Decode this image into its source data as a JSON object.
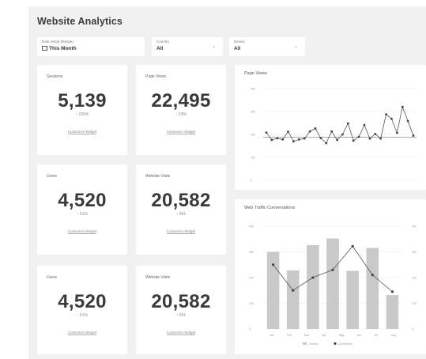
{
  "page": {
    "title": "Website Analytics"
  },
  "filters": [
    {
      "label": "Date range (Range)",
      "value": "This Month",
      "icon": "calendar-icon"
    },
    {
      "label": "Country",
      "value": "All",
      "icon": "chevron-down-icon"
    },
    {
      "label": "Device",
      "value": "All",
      "icon": "chevron-down-icon"
    }
  ],
  "cards": [
    {
      "label": "Sessions",
      "value": "5,139",
      "delta": "↑ 100%",
      "link": "Customize Widget"
    },
    {
      "label": "Page Views",
      "value": "22,495",
      "delta": "↑ 23%",
      "link": "Customize Widget"
    },
    {
      "label": "Users",
      "value": "4,520",
      "delta": "↑ 91%",
      "link": "Customize Widget"
    },
    {
      "label": "Website Visits",
      "value": "20,582",
      "delta": "↑ 591",
      "link": "Customize Widget"
    },
    {
      "label": "Users",
      "value": "4,520",
      "delta": "↑ 91%",
      "link": "Customize Widget"
    },
    {
      "label": "Website Visits",
      "value": "20,582",
      "delta": "↑ 591",
      "link": "Customize Widget"
    }
  ],
  "colors": {
    "background": "#f1f1f1",
    "card": "#ffffff",
    "bar": "#c9c9c9",
    "line": "#555555"
  },
  "chart_data": [
    {
      "type": "line",
      "title": "Page Views",
      "ylim": [
        0,
        400
      ],
      "yticks": [
        "400",
        "300",
        "200",
        "100",
        "0"
      ],
      "values": [
        208,
        176,
        183,
        178,
        212,
        170,
        178,
        182,
        213,
        226,
        184,
        162,
        213,
        176,
        200,
        248,
        173,
        190,
        241,
        182,
        202,
        182,
        288,
        268,
        207,
        320,
        258,
        195
      ],
      "reference_value": 188,
      "grid": true
    },
    {
      "type": "bar",
      "title": "Web Traffic Conversations",
      "categories": [
        "Jan",
        "Feb",
        "Mar",
        "Apr",
        "May",
        "Jun",
        "Jul",
        "Aug"
      ],
      "series": [
        {
          "type": "bar",
          "values": [
            300,
            228,
            326,
            352,
            226,
            315,
            132
          ]
        },
        {
          "type": "line",
          "values": [
            250,
            150,
            200,
            230,
            322,
            210,
            145
          ]
        }
      ],
      "ylim": [
        0,
        400
      ],
      "yticks_left": [
        "400",
        "300",
        "200",
        "100",
        "0"
      ],
      "yticks_right": [
        "400",
        "300",
        "200",
        "100",
        "0"
      ],
      "legend": [
        "Volume",
        "Conversion"
      ],
      "legend_position": "bottom"
    }
  ]
}
